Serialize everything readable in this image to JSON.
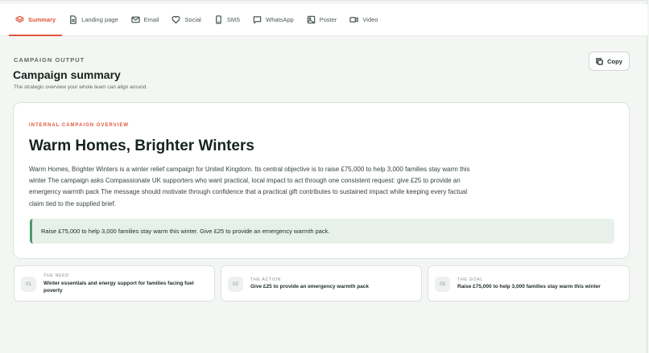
{
  "tabs": [
    {
      "label": "Summary",
      "icon": "layers-icon",
      "active": true
    },
    {
      "label": "Landing page",
      "icon": "document-icon",
      "active": false
    },
    {
      "label": "Email",
      "icon": "mail-icon",
      "active": false
    },
    {
      "label": "Social",
      "icon": "heart-icon",
      "active": false
    },
    {
      "label": "SMS",
      "icon": "phone-icon",
      "active": false
    },
    {
      "label": "WhatsApp",
      "icon": "chat-bubble-icon",
      "active": false
    },
    {
      "label": "Poster",
      "icon": "image-icon",
      "active": false
    },
    {
      "label": "Video",
      "icon": "video-icon",
      "active": false
    }
  ],
  "header": {
    "eyebrow": "CAMPAIGN OUTPUT",
    "title": "Campaign summary",
    "subtitle": "The strategic overview your whole team can align around.",
    "copy_label": "Copy"
  },
  "card": {
    "eyebrow": "INTERNAL CAMPAIGN OVERVIEW",
    "title": "Warm Homes, Brighter Winters",
    "body": "Warm Homes, Brighter Winters is a winter relief campaign for United Kingdom. Its central objective is to raise £75,000 to help 3,000 families stay warm this winter The campaign asks Compassionate UK supporters who want practical, local impact to act through one consistent request: give £25 to provide an emergency warmth pack The message should motivate through confidence that a practical gift contributes to sustained impact while keeping every factual claim tied to the supplied brief.",
    "callout": "Raise £75,000 to help 3,000 families stay warm this winter. Give £25 to provide an emergency warmth pack."
  },
  "summary": [
    {
      "num": "01",
      "label": "THE NEED",
      "value": "Winter essentials and energy support for families facing fuel poverty"
    },
    {
      "num": "02",
      "label": "THE ACTION",
      "value": "Give £25 to provide an emergency warmth pack"
    },
    {
      "num": "03",
      "label": "THE GOAL",
      "value": "Raise £75,000 to help 3,000 families stay warm this winter"
    }
  ],
  "colors": {
    "accent": "#e2563c",
    "callout_bg": "#e7f1ea",
    "callout_border": "#4e9a6a",
    "page_bg": "#f4f6f4"
  }
}
